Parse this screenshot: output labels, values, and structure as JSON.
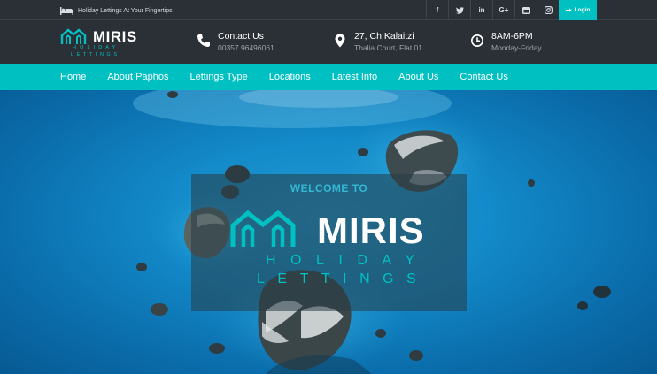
{
  "topbar": {
    "tagline": "Holiday Lettings At Your Fingertips",
    "social": [
      {
        "icon": "facebook-icon",
        "glyph": "f"
      },
      {
        "icon": "twitter-icon",
        "glyph": "t"
      },
      {
        "icon": "linkedin-icon",
        "glyph": "in"
      },
      {
        "icon": "google-plus-icon",
        "glyph": "G+"
      },
      {
        "icon": "youtube-icon",
        "glyph": "▶"
      },
      {
        "icon": "instagram-icon",
        "glyph": "◎"
      }
    ],
    "login_label": "Login"
  },
  "header": {
    "logo": {
      "word": "MIRIS",
      "sub1": "HOLIDAY",
      "sub2": "LETTINGS"
    },
    "contact": {
      "title": "Contact Us",
      "value": "00357 96496061"
    },
    "address": {
      "title": "27, Ch Kalaitzi",
      "value": "Thalia Court, Flat 01"
    },
    "hours": {
      "title": "8AM-6PM",
      "value": "Monday-Friday"
    }
  },
  "nav": {
    "items": [
      "Home",
      "About Paphos",
      "Lettings Type",
      "Locations",
      "Latest Info",
      "About Us",
      "Contact Us"
    ]
  },
  "hero": {
    "welcome": "WELCOME TO",
    "word": "MIRIS",
    "sub1": "HOLIDAY",
    "sub2": "LETTINGS"
  },
  "colors": {
    "accent": "#00c0c2",
    "dark": "#2b3036",
    "sea": "#138ac9"
  }
}
